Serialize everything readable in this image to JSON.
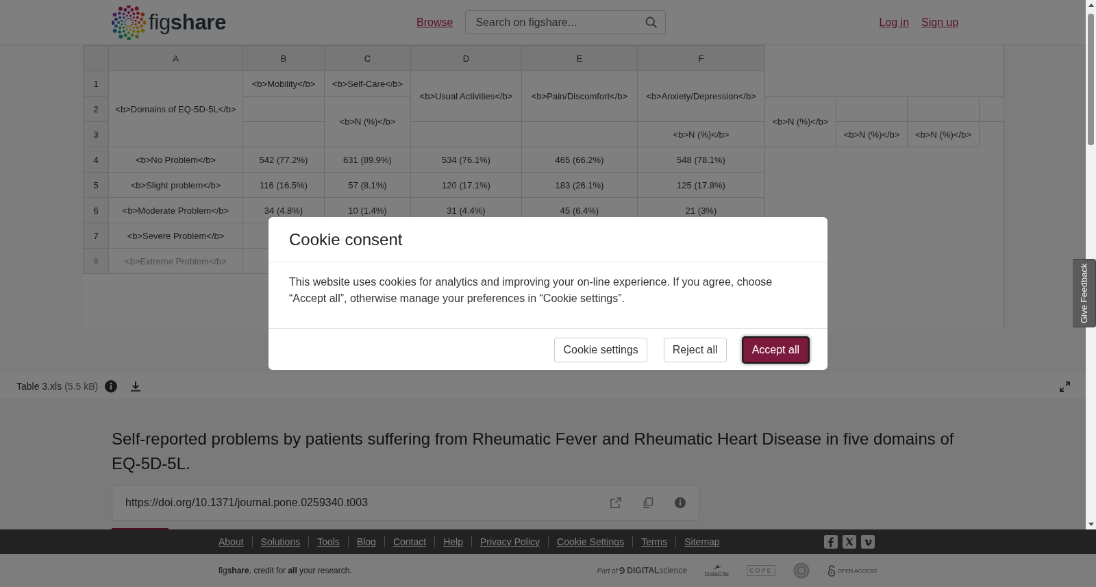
{
  "header": {
    "logo": "fig**share**",
    "browse_link": "Browse",
    "search": {
      "placeholder": "Search on figshare..."
    },
    "account_links": [
      "Log in",
      "Sign up"
    ]
  },
  "spreadsheet": {
    "column_headers": [
      "A",
      "B",
      "C",
      "D",
      "E",
      "F"
    ],
    "rows": [
      {
        "number": "1",
        "cells": [
          {
            "kind": "text",
            "text": "<b>Domains of EQ-5D-5L</b>",
            "rowspan": 3
          },
          {
            "kind": "text",
            "text": "<b>Mobility</b>"
          },
          {
            "kind": "text",
            "text": "<b>Self-Care</b>"
          },
          {
            "kind": "text",
            "text": "<b>Usual Activities</b>",
            "rowspan": 2
          },
          {
            "kind": "text",
            "text": "<b>Pain/Discomfort</b>",
            "rowspan": 2
          },
          {
            "kind": "text",
            "text": "<b>Anxiety/Depression</b>",
            "rowspan": 2
          }
        ]
      },
      {
        "number": "2",
        "cells": [
          {
            "kind": "blank"
          },
          {
            "kind": "text",
            "text": "<b>N (%)</b>",
            "rowspan": 2
          },
          {
            "kind": "text",
            "text": "<b>N (%)</b>",
            "rowspan": 2
          },
          {
            "kind": "blank"
          },
          {
            "kind": "blank"
          },
          {
            "kind": "blank"
          }
        ]
      },
      {
        "number": "3",
        "cells": [
          {
            "kind": "blank"
          },
          {
            "kind": "blank"
          },
          {
            "kind": "blank"
          },
          {
            "kind": "text",
            "text": "<b>N (%)</b>"
          },
          {
            "kind": "text",
            "text": "<b>N (%)</b>"
          },
          {
            "kind": "text",
            "text": "<b>N (%)</b>"
          }
        ]
      },
      {
        "number": "4",
        "cells": [
          {
            "kind": "text",
            "text": "<b>No Problem</b>"
          },
          {
            "kind": "text",
            "text": "542 (77.2%)"
          },
          {
            "kind": "text",
            "text": "631 (89.9%)"
          },
          {
            "kind": "text",
            "text": "534 (76.1%)"
          },
          {
            "kind": "text",
            "text": "465 (66.2%)"
          },
          {
            "kind": "text",
            "text": "548 (78.1%)"
          }
        ]
      },
      {
        "number": "5",
        "cells": [
          {
            "kind": "text",
            "text": "<b>Slight problem</b>"
          },
          {
            "kind": "text",
            "text": "116 (16.5%)"
          },
          {
            "kind": "text",
            "text": "57 (8.1%)"
          },
          {
            "kind": "text",
            "text": "120 (17.1%)"
          },
          {
            "kind": "text",
            "text": "183 (26.1%)"
          },
          {
            "kind": "text",
            "text": "125 (17.8%)"
          }
        ]
      },
      {
        "number": "6",
        "cells": [
          {
            "kind": "text",
            "text": "<b>Moderate Problem</b>"
          },
          {
            "kind": "text",
            "text": "34 (4.8%)"
          },
          {
            "kind": "text",
            "text": "10 (1.4%)"
          },
          {
            "kind": "text",
            "text": "31 (4.4%)"
          },
          {
            "kind": "text",
            "text": "45 (6.4%)"
          },
          {
            "kind": "text",
            "text": "21 (3%)"
          }
        ]
      },
      {
        "number": "7",
        "cells": [
          {
            "kind": "text",
            "text": "<b>Severe Problem</b>"
          },
          {
            "kind": "blank"
          },
          {
            "kind": "blank"
          },
          {
            "kind": "blank"
          },
          {
            "kind": "blank"
          },
          {
            "kind": "blank"
          }
        ]
      },
      {
        "number": "8",
        "cells": [
          {
            "kind": "text",
            "text": "<b>Extreme Problem</b>"
          },
          {
            "kind": "blank"
          },
          {
            "kind": "blank"
          },
          {
            "kind": "blank"
          },
          {
            "kind": "blank"
          },
          {
            "kind": "blank"
          }
        ]
      }
    ]
  },
  "file_bar": {
    "file_name": "Table 3.xls",
    "file_size": "(5.5 kB)"
  },
  "item": {
    "title": "Self-reported problems by patients suffering from Rheumatic Fever and Rheumatic Heart Disease in five domains of EQ-5D-5L.",
    "doi": "https://doi.org/10.1371/journal.pone.0259340.t003"
  },
  "cookie_dialog": {
    "title": "Cookie consent",
    "message": "This website uses cookies for analytics and improving your on-line experience. If you agree, choose “Accept all”, otherwise manage your preferences in “Cookie settings”.",
    "buttons": [
      {
        "label": "Cookie settings",
        "kind": "secondary",
        "focused": false
      },
      {
        "label": "Reject all",
        "kind": "secondary",
        "focused": false
      },
      {
        "label": "Accept all",
        "kind": "primary",
        "focused": true
      }
    ]
  },
  "feedback_tab": {
    "label": "Give Feedback"
  },
  "footer": {
    "links": [
      "About",
      "Solutions",
      "Tools",
      "Blog",
      "Contact",
      "Help",
      "Privacy Policy",
      "Cookie Settings",
      "Terms",
      "Sitemap"
    ],
    "tagline": "fig**share**. credit for **all** your research.",
    "partners": [
      {
        "kind": "digital_science",
        "prefix": "Part of",
        "name": "**DIGITAL**science"
      },
      {
        "kind": "datacite",
        "name": "DataCite"
      },
      {
        "kind": "cope",
        "name": "COPE"
      },
      {
        "kind": "seal"
      },
      {
        "kind": "open_access",
        "name": "OPEN ACCESS"
      }
    ]
  }
}
